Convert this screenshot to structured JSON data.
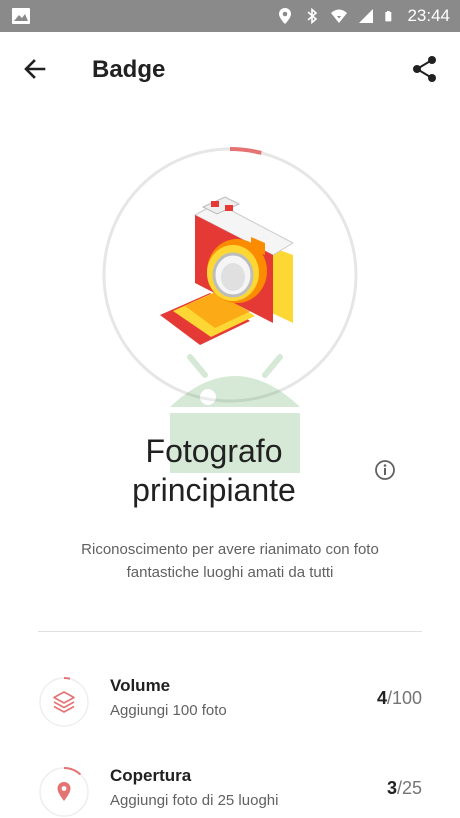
{
  "status_bar": {
    "time": "23:44",
    "icons": [
      "image-notification-icon",
      "location-icon",
      "bluetooth-icon",
      "wifi-icon",
      "signal-icon",
      "battery-icon"
    ]
  },
  "app_bar": {
    "title": "Badge",
    "back_icon": "arrow-back-icon",
    "share_icon": "share-icon"
  },
  "badge": {
    "name_line1": "Fotografo",
    "name_line2": "principiante",
    "description_line1": "Riconoscimento per avere rianimato con foto",
    "description_line2": "fantastiche luoghi amati da tutti",
    "progress_fraction": 0.04,
    "icon": "camera-badge-icon"
  },
  "requirements": [
    {
      "name": "Volume",
      "subtitle": "Aggiungi 100 foto",
      "current": "4",
      "total": "/100",
      "progress_fraction": 0.04,
      "icon": "layers-icon"
    },
    {
      "name": "Copertura",
      "subtitle": "Aggiungi foto di 25 luoghi",
      "current": "3",
      "total": "/25",
      "progress_fraction": 0.12,
      "icon": "place-pin-icon"
    }
  ],
  "colors": {
    "accent": "#E57373",
    "status_bar": "#8A8A8A",
    "ring_track": "#E6E6E6",
    "camera_red": "#E53935",
    "camera_yellow": "#FDD835",
    "camera_orange": "#FB8C00"
  }
}
